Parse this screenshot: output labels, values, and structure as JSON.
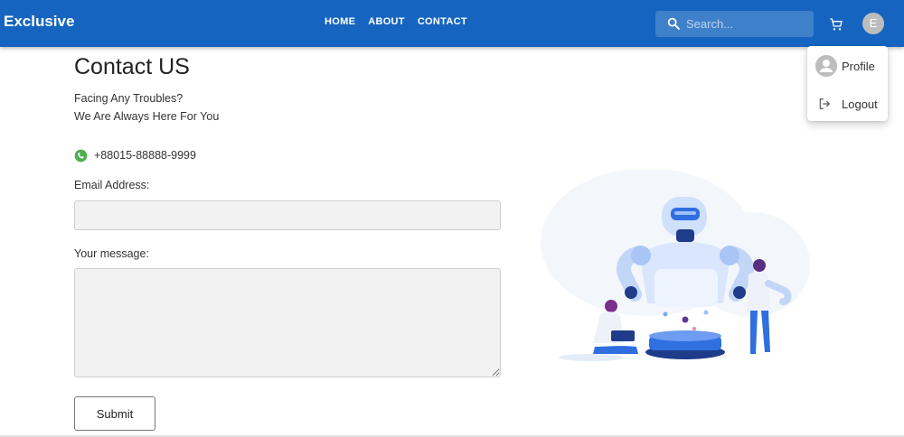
{
  "header": {
    "brand": "Exclusive",
    "nav": [
      "HOME",
      "ABOUT",
      "CONTACT"
    ],
    "search_placeholder": "Search...",
    "avatar_letter": "E"
  },
  "user_menu": {
    "items": [
      "Profile",
      "Logout"
    ]
  },
  "contact": {
    "title": "Contact US",
    "subtitle_line1": "Facing Any Troubles?",
    "subtitle_line2": "We Are Always Here For You",
    "phone": "+88015-88888-9999",
    "email_label": "Email Address:",
    "email_value": "",
    "message_label": "Your message:",
    "message_value": "",
    "submit_label": "Submit"
  },
  "colors": {
    "appbar": "#1565c0",
    "whatsapp": "#4caf50",
    "illustration_accent": "#2f6fe0"
  },
  "icons": [
    "search-icon",
    "cart-icon",
    "profile-icon",
    "logout-icon",
    "whatsapp-icon"
  ]
}
